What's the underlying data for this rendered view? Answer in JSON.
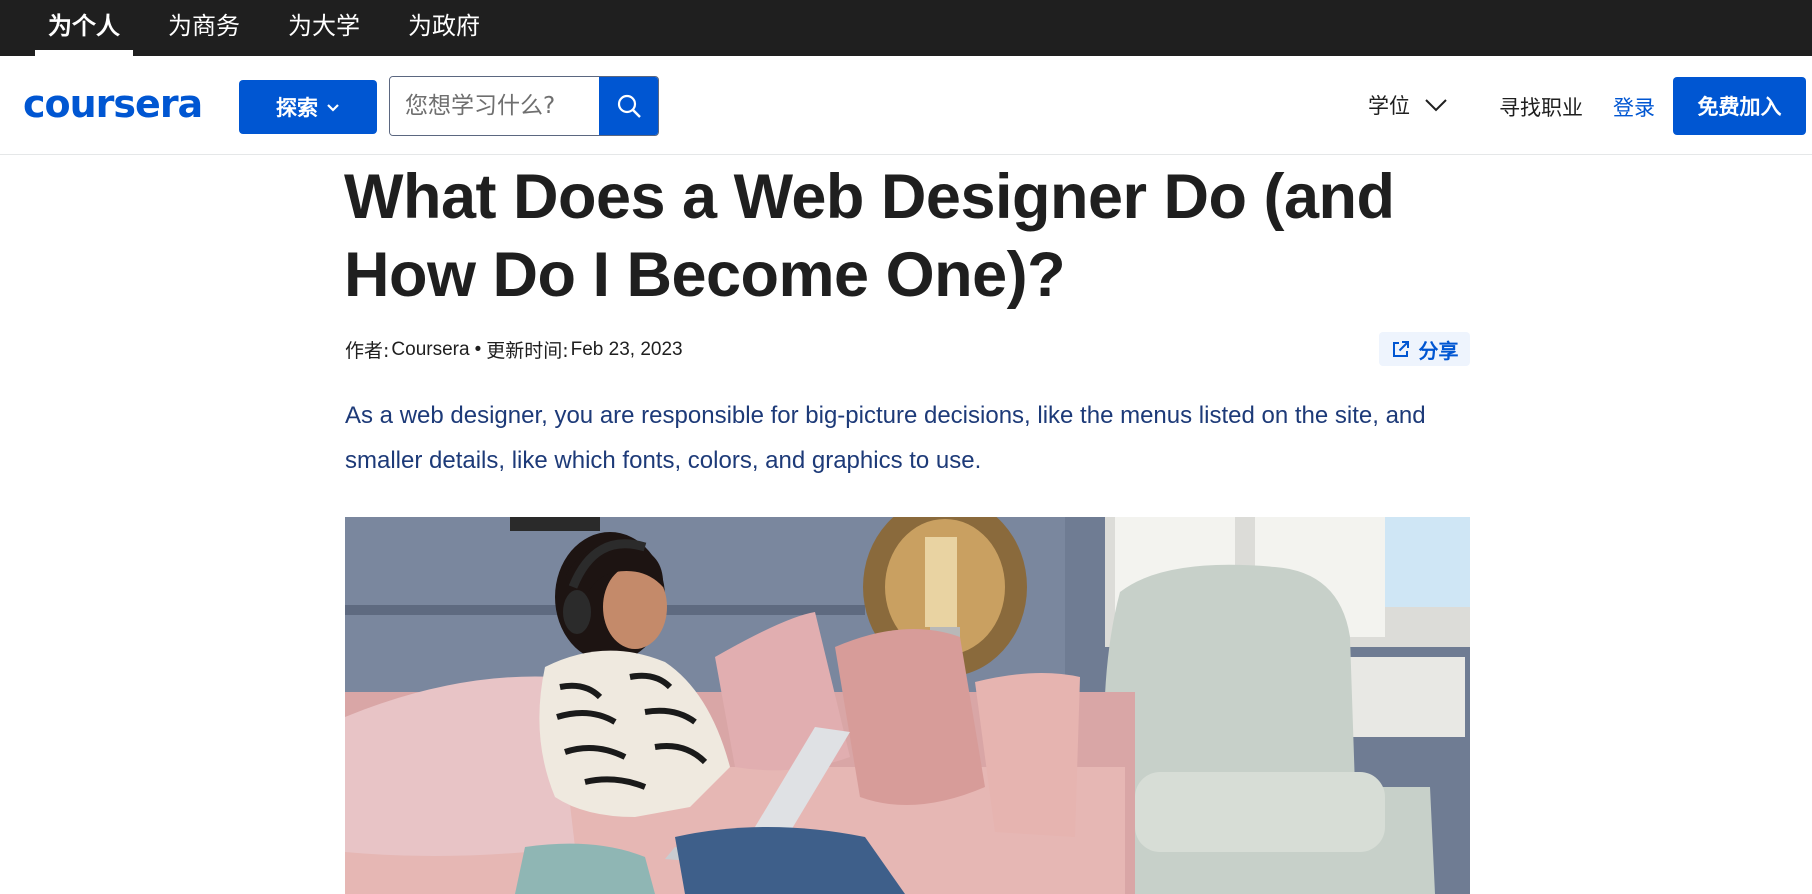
{
  "topbar": {
    "items": [
      {
        "label": "为个人",
        "active": true
      },
      {
        "label": "为商务",
        "active": false
      },
      {
        "label": "为大学",
        "active": false
      },
      {
        "label": "为政府",
        "active": false
      }
    ]
  },
  "header": {
    "logo": "coursera",
    "explore_label": "探索",
    "search_placeholder": "您想学习什么?",
    "degree_label": "学位",
    "career_label": "寻找职业",
    "login_label": "登录",
    "join_label": "免费加入"
  },
  "article": {
    "title": "What Does a Web Designer Do (and How Do I Become One)?",
    "author_prefix": "作者:",
    "author": "Coursera",
    "separator": "•",
    "updated_prefix": "更新时间:",
    "updated_date": "Feb 23, 2023",
    "share_label": "分享",
    "lede": "As a web designer, you are responsible for big-picture decisions, like the menus listed on the site, and smaller details, like which fonts, colors, and graphics to use."
  },
  "icons": {
    "explore_chevron": "chevron-down-icon",
    "search": "search-icon",
    "degree_chevron": "chevron-down-icon",
    "share": "share-icon"
  },
  "colors": {
    "brand": "#0056d2",
    "topbar_bg": "#1f1f1f",
    "lede_text": "#1d3a78",
    "share_bg": "#eef4fd"
  }
}
